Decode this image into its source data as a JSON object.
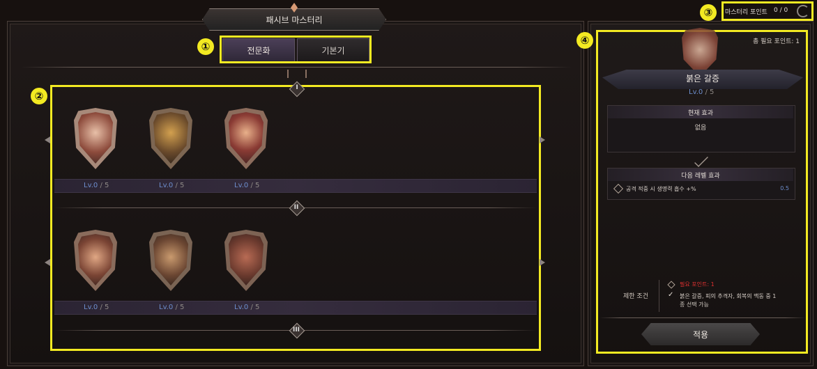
{
  "window": {
    "title": "패시브 마스터리"
  },
  "tabs": [
    {
      "label": "전문화"
    },
    {
      "label": "기본기"
    }
  ],
  "header": {
    "mastery_points_label": "마스터리 포인트",
    "mastery_points_value": "0 / 0"
  },
  "annotations": [
    "①",
    "②",
    "③",
    "④"
  ],
  "tiers": [
    {
      "numeral": "I",
      "skills": [
        {
          "icon": "sword-heart-crest-icon",
          "level": "Lv.0",
          "max": "5"
        },
        {
          "icon": "beast-crest-icon",
          "level": "Lv.0",
          "max": "5"
        },
        {
          "icon": "heart-crest-icon",
          "level": "Lv.0",
          "max": "5"
        }
      ]
    },
    {
      "numeral": "II",
      "skills": [
        {
          "icon": "slash-crest-icon",
          "level": "Lv.0",
          "max": "5"
        },
        {
          "icon": "claw-crest-icon",
          "level": "Lv.0",
          "max": "5"
        },
        {
          "icon": "shield-crest-icon",
          "level": "Lv.0",
          "max": "5"
        }
      ]
    },
    {
      "numeral": "III",
      "skills": []
    }
  ],
  "detail": {
    "total_points": "총 필요 포인트: 1",
    "skill_name": "붉은 갈증",
    "level": "Lv.0",
    "max": "5",
    "current_effect_title": "현재 효과",
    "current_effect_value": "없음",
    "next_effect_title": "다음 레벨 효과",
    "next_effect_desc": "공격 적중 시 생명력 흡수 +%",
    "next_effect_value": "0.5",
    "restrict_label": "제한 조건",
    "restrict_req": "필요 포인트: 1",
    "restrict_note_line1": "붉은 갈증, 피의 추격자, 회복의 맥동 중 1",
    "restrict_note_line2": "종 선택 가능",
    "apply_label": "적용"
  },
  "colors": {
    "highlight": "#f3ea22",
    "level_blue": "#6e8fcf",
    "required_red": "#e03030",
    "tab_active": "#4b3f58"
  }
}
